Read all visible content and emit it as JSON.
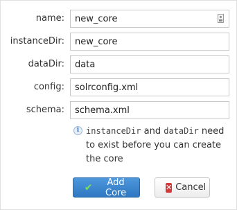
{
  "form": {
    "fields": [
      {
        "label": "name:",
        "value": "new_core"
      },
      {
        "label": "instanceDir:",
        "value": "new_core"
      },
      {
        "label": "dataDir:",
        "value": "data"
      },
      {
        "label": "config:",
        "value": "solrconfig.xml"
      },
      {
        "label": "schema:",
        "value": "schema.xml"
      }
    ]
  },
  "info": {
    "code1": "instanceDir",
    "and": " and ",
    "code2": "dataDir",
    "rest": " need to exist before you can create the core"
  },
  "buttons": {
    "add_label": "Add Core",
    "cancel_label": "Cancel"
  },
  "icons": {
    "info": "info-icon",
    "add": "checkmark-icon",
    "cancel": "close-icon",
    "field_badge": "contact-card-icon"
  }
}
